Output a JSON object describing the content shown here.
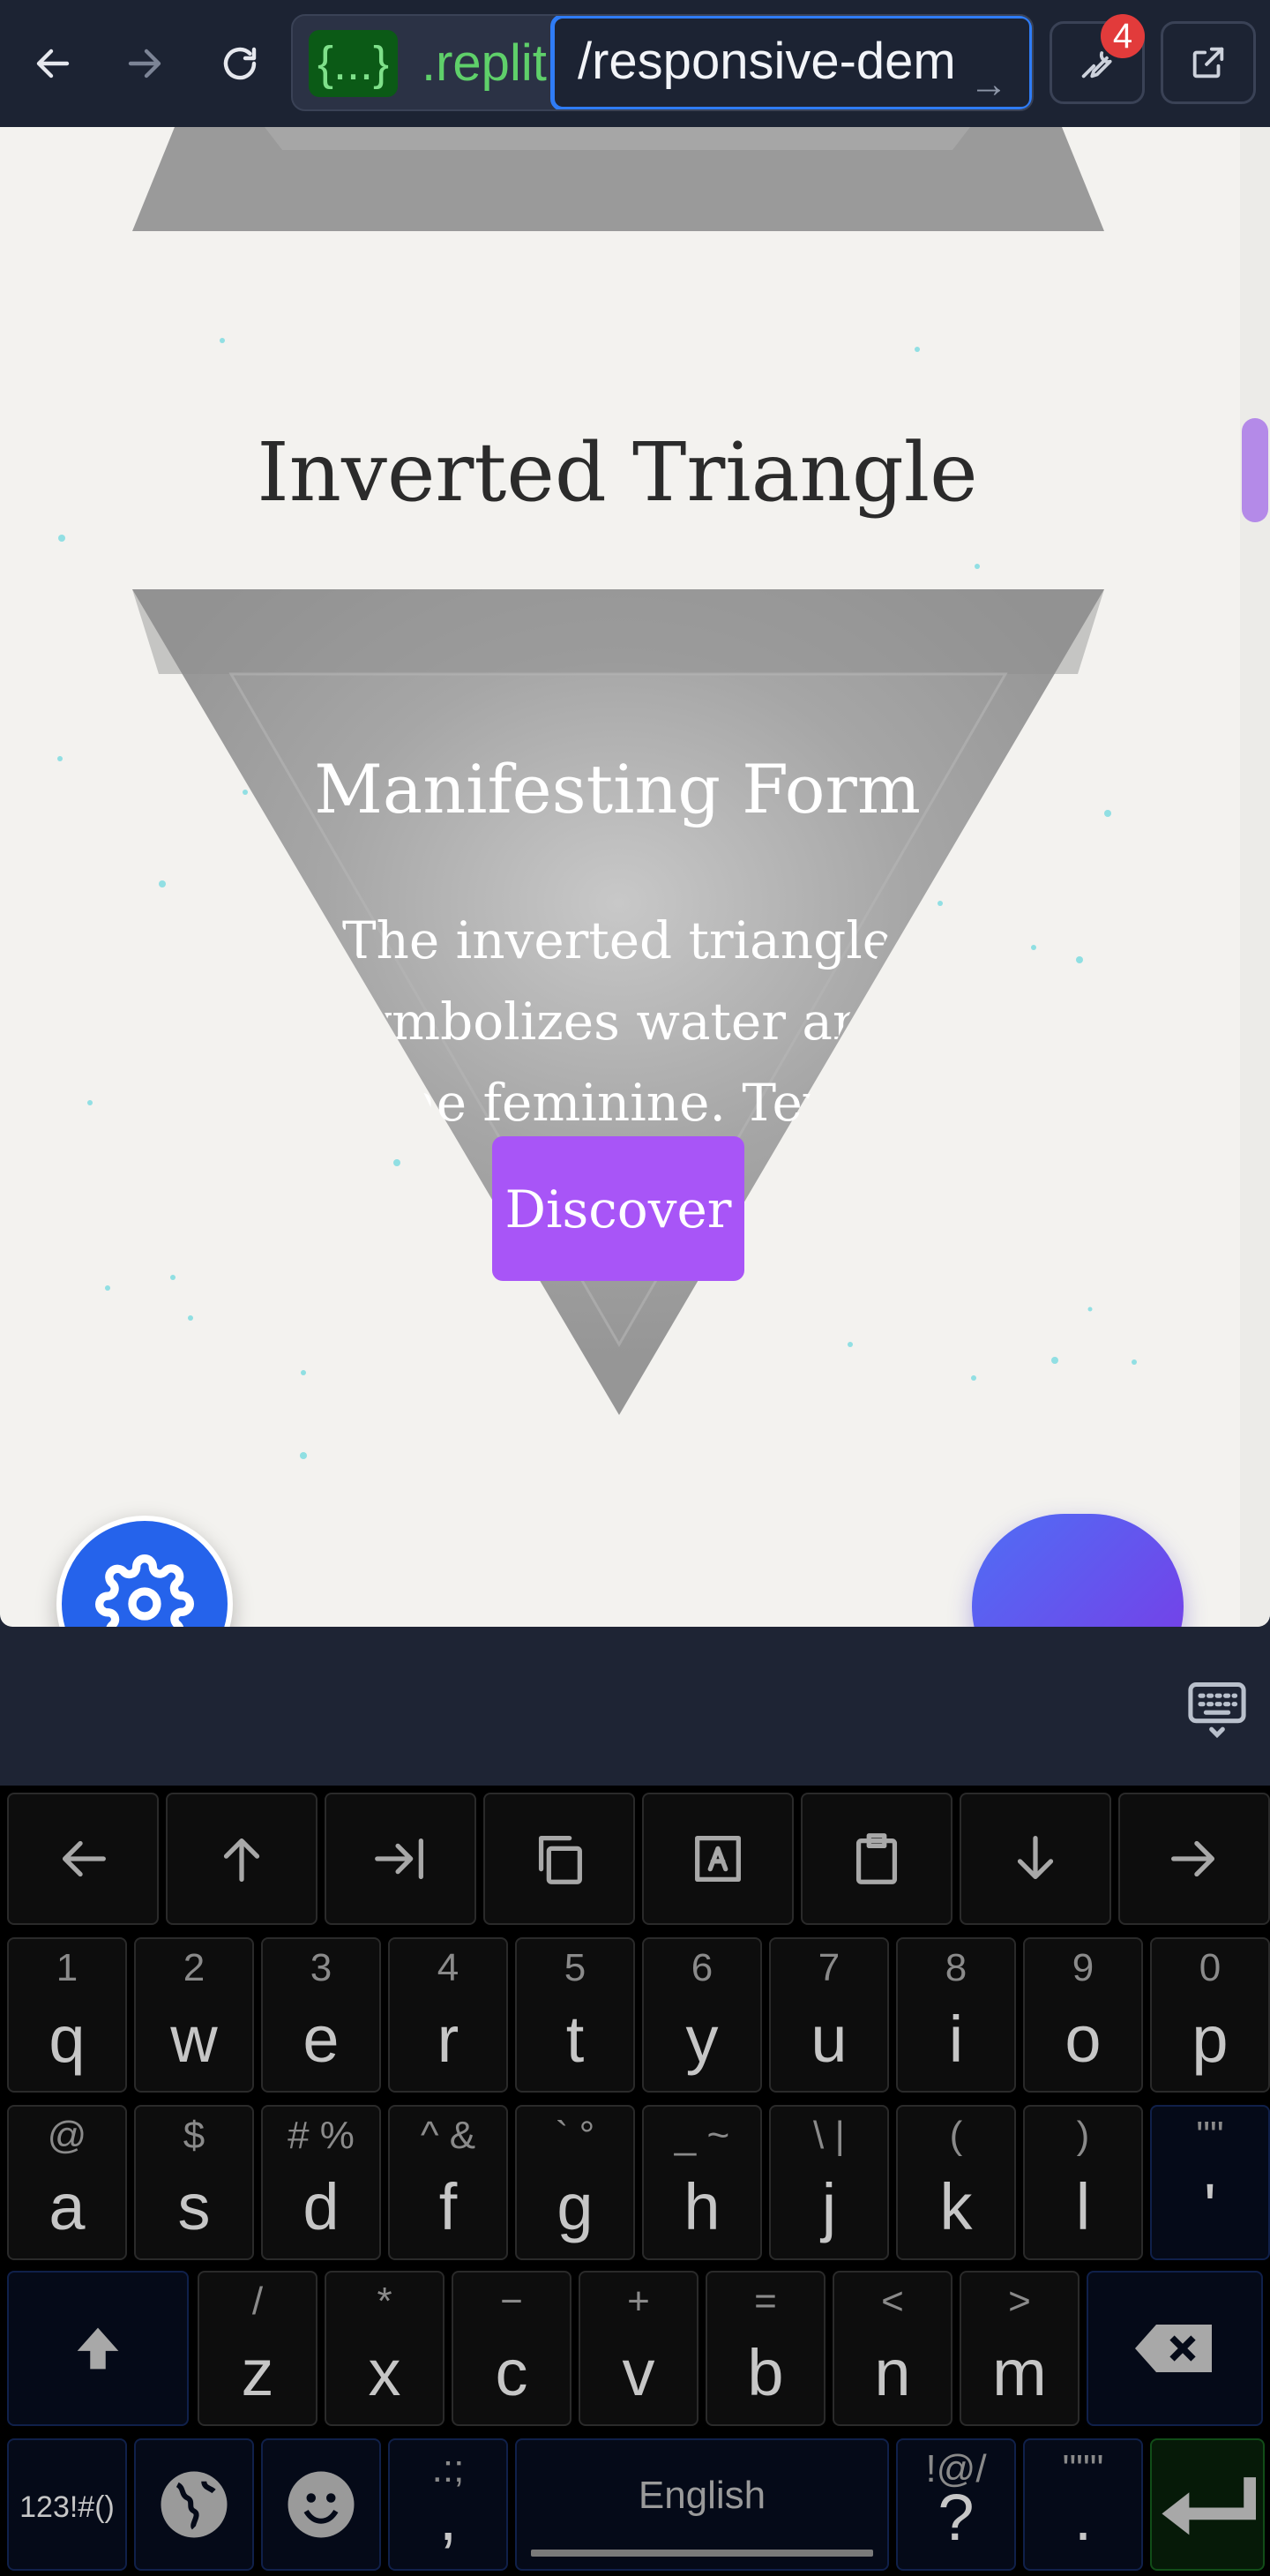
{
  "browser": {
    "url_host_badge": "{...}",
    "url_host_rest": ".replit",
    "url_path": "/responsive-dem",
    "url_go_glyph": "→",
    "tools_badge_count": "4"
  },
  "page": {
    "section_title": "Inverted Triangle",
    "card_title": "Manifesting Form",
    "card_body": "The inverted triangle symbolizes water and the feminine. Text adapts to",
    "discover_label": "Discover",
    "colors": {
      "background": "#f3f2ef",
      "accent": "#a855f7",
      "fab_blue": "#2563eb"
    }
  },
  "keyboard": {
    "toolbar": [
      "left-arrow-icon",
      "up-arrow-icon",
      "tab-end-icon",
      "copy-icon",
      "select-all-icon",
      "clipboard-icon",
      "down-arrow-icon",
      "right-arrow-icon"
    ],
    "row1": [
      {
        "main": "q",
        "sub": "1"
      },
      {
        "main": "w",
        "sub": "2"
      },
      {
        "main": "e",
        "sub": "3"
      },
      {
        "main": "r",
        "sub": "4"
      },
      {
        "main": "t",
        "sub": "5"
      },
      {
        "main": "y",
        "sub": "6"
      },
      {
        "main": "u",
        "sub": "7"
      },
      {
        "main": "i",
        "sub": "8"
      },
      {
        "main": "o",
        "sub": "9"
      },
      {
        "main": "p",
        "sub": "0"
      }
    ],
    "row2": [
      {
        "main": "a",
        "sub": "@"
      },
      {
        "main": "s",
        "sub": "$"
      },
      {
        "main": "d",
        "sub": "# %"
      },
      {
        "main": "f",
        "sub": "^ &"
      },
      {
        "main": "g",
        "sub": "` °"
      },
      {
        "main": "h",
        "sub": "_ ~"
      },
      {
        "main": "j",
        "sub": "\\ |"
      },
      {
        "main": "k",
        "sub": "("
      },
      {
        "main": "l",
        "sub": ")"
      },
      {
        "main": "'",
        "sub": "\"\""
      }
    ],
    "row3": [
      {
        "main": "z",
        "sub": "/"
      },
      {
        "main": "x",
        "sub": "*"
      },
      {
        "main": "c",
        "sub": "−"
      },
      {
        "main": "v",
        "sub": "+"
      },
      {
        "main": "b",
        "sub": "="
      },
      {
        "main": "n",
        "sub": "<"
      },
      {
        "main": "m",
        "sub": ">"
      }
    ],
    "symbols_label": "123!#()",
    "comma_main": ",",
    "comma_sub": ".:;",
    "space_label": "English",
    "question_main": "?",
    "question_sub": "!@/",
    "period_main": ".",
    "period_sub": "\"\"\""
  }
}
